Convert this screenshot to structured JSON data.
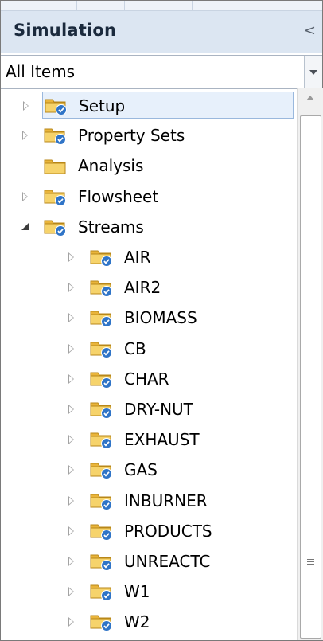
{
  "panel": {
    "title": "Simulation",
    "collapse_glyph": "<"
  },
  "filter": {
    "value": "All Items"
  },
  "tree": [
    {
      "label": "Setup",
      "expander": "right",
      "icon": "folder-check-icon",
      "level": 0,
      "selected": true
    },
    {
      "label": "Property Sets",
      "expander": "right",
      "icon": "folder-check-icon",
      "level": 0,
      "selected": false
    },
    {
      "label": "Analysis",
      "expander": "none",
      "icon": "folder-icon",
      "level": 0,
      "selected": false
    },
    {
      "label": "Flowsheet",
      "expander": "right",
      "icon": "folder-check-icon",
      "level": 0,
      "selected": false
    },
    {
      "label": "Streams",
      "expander": "down",
      "icon": "folder-check-icon",
      "level": 0,
      "selected": false
    },
    {
      "label": "AIR",
      "expander": "right",
      "icon": "folder-check-icon",
      "level": 1,
      "selected": false
    },
    {
      "label": "AIR2",
      "expander": "right",
      "icon": "folder-check-icon",
      "level": 1,
      "selected": false
    },
    {
      "label": "BIOMASS",
      "expander": "right",
      "icon": "folder-check-icon",
      "level": 1,
      "selected": false
    },
    {
      "label": "CB",
      "expander": "right",
      "icon": "folder-check-icon",
      "level": 1,
      "selected": false
    },
    {
      "label": "CHAR",
      "expander": "right",
      "icon": "folder-check-icon",
      "level": 1,
      "selected": false
    },
    {
      "label": "DRY-NUT",
      "expander": "right",
      "icon": "folder-check-icon",
      "level": 1,
      "selected": false
    },
    {
      "label": "EXHAUST",
      "expander": "right",
      "icon": "folder-check-icon",
      "level": 1,
      "selected": false
    },
    {
      "label": "GAS",
      "expander": "right",
      "icon": "folder-check-icon",
      "level": 1,
      "selected": false
    },
    {
      "label": "INBURNER",
      "expander": "right",
      "icon": "folder-check-icon",
      "level": 1,
      "selected": false
    },
    {
      "label": "PRODUCTS",
      "expander": "right",
      "icon": "folder-check-icon",
      "level": 1,
      "selected": false
    },
    {
      "label": "UNREACTC",
      "expander": "right",
      "icon": "folder-check-icon",
      "level": 1,
      "selected": false
    },
    {
      "label": "W1",
      "expander": "right",
      "icon": "folder-check-icon",
      "level": 1,
      "selected": false
    },
    {
      "label": "W2",
      "expander": "right",
      "icon": "folder-check-icon",
      "level": 1,
      "selected": false
    }
  ],
  "colors": {
    "header_bg": "#dce6f2",
    "selection_bg": "#e7f0fb",
    "selection_border": "#9ab8dd",
    "folder_yellow": "#f2c64d",
    "check_blue": "#2f74c7"
  }
}
